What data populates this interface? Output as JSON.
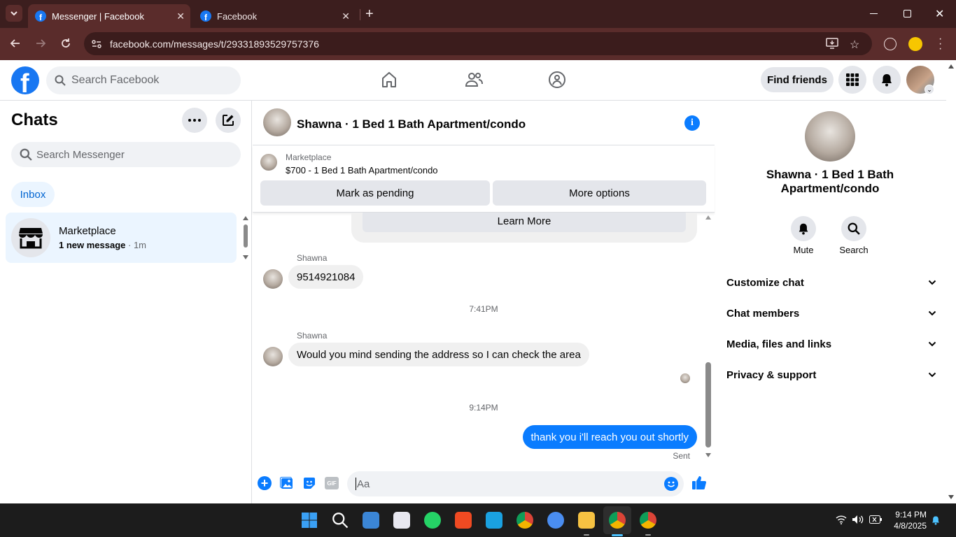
{
  "browser": {
    "tabs": [
      {
        "title": "Messenger | Facebook",
        "active": true
      },
      {
        "title": "Facebook",
        "active": false
      }
    ],
    "url": "facebook.com/messages/t/29331893529757376"
  },
  "header": {
    "search_placeholder": "Search Facebook",
    "find_friends": "Find friends"
  },
  "sidebar": {
    "title": "Chats",
    "search_placeholder": "Search Messenger",
    "filter": "Inbox",
    "chats": [
      {
        "name": "Marketplace",
        "preview": "1 new message",
        "time": "· 1m"
      }
    ]
  },
  "conversation": {
    "title": "Shawna · 1 Bed 1 Bath Apartment/condo",
    "marketplace_label": "Marketplace",
    "listing": "$700 - 1 Bed 1 Bath Apartment/condo",
    "mark_pending": "Mark as pending",
    "more_options": "More options",
    "learn_more": "Learn More",
    "messages": [
      {
        "sender": "Shawna",
        "text": "9514921084"
      },
      {
        "timestamp": "7:41PM"
      },
      {
        "sender": "Shawna",
        "text": "Would you mind sending the address so I can check the area"
      },
      {
        "timestamp": "9:14PM"
      },
      {
        "sender": "me",
        "text": "thank you i'll reach you out shortly",
        "status": "Sent"
      }
    ],
    "composer_placeholder": "Aa",
    "gif_label": "GIF"
  },
  "details": {
    "title": "Shawna · 1 Bed 1 Bath Apartment/condo",
    "actions": [
      {
        "label": "Mute"
      },
      {
        "label": "Search"
      }
    ],
    "sections": [
      "Customize chat",
      "Chat members",
      "Media, files and links",
      "Privacy & support"
    ]
  },
  "taskbar": {
    "time": "9:14 PM",
    "date": "4/8/2025"
  },
  "colors": {
    "accent": "#0a7cff",
    "fb_blue": "#1877f2",
    "chrome_frame": "#3c1e1e"
  }
}
